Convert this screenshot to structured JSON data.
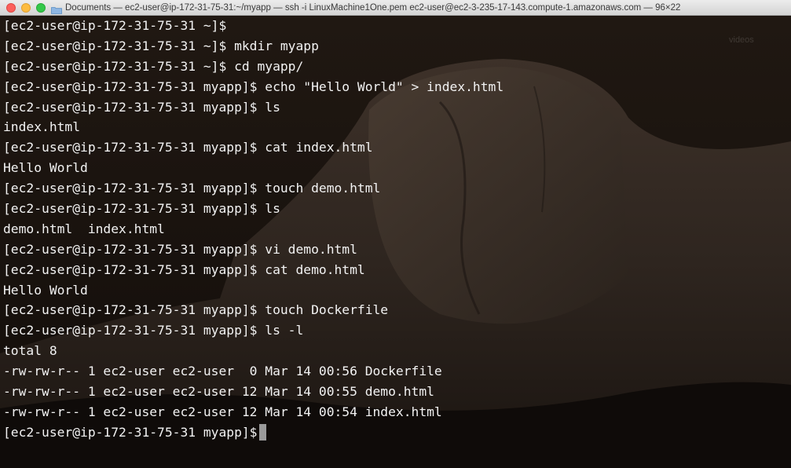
{
  "window": {
    "title": "Documents — ec2-user@ip-172-31-75-31:~/myapp — ssh -i LinuxMachine1One.pem ec2-user@ec2-3-235-17-143.compute-1.amazonaws.com — 96×22"
  },
  "watermark": "videos",
  "terminal": {
    "lines": [
      "[ec2-user@ip-172-31-75-31 ~]$",
      "[ec2-user@ip-172-31-75-31 ~]$ mkdir myapp",
      "[ec2-user@ip-172-31-75-31 ~]$ cd myapp/",
      "[ec2-user@ip-172-31-75-31 myapp]$ echo \"Hello World\" > index.html",
      "[ec2-user@ip-172-31-75-31 myapp]$ ls",
      "index.html",
      "[ec2-user@ip-172-31-75-31 myapp]$ cat index.html",
      "Hello World",
      "[ec2-user@ip-172-31-75-31 myapp]$ touch demo.html",
      "[ec2-user@ip-172-31-75-31 myapp]$ ls",
      "demo.html  index.html",
      "[ec2-user@ip-172-31-75-31 myapp]$ vi demo.html",
      "[ec2-user@ip-172-31-75-31 myapp]$ cat demo.html",
      "Hello World",
      "[ec2-user@ip-172-31-75-31 myapp]$ touch Dockerfile",
      "[ec2-user@ip-172-31-75-31 myapp]$ ls -l",
      "total 8",
      "-rw-rw-r-- 1 ec2-user ec2-user  0 Mar 14 00:56 Dockerfile",
      "-rw-rw-r-- 1 ec2-user ec2-user 12 Mar 14 00:55 demo.html",
      "-rw-rw-r-- 1 ec2-user ec2-user 12 Mar 14 00:54 index.html",
      "[ec2-user@ip-172-31-75-31 myapp]$"
    ]
  },
  "colors": {
    "text": "#f2f2f2",
    "background": "#16110d",
    "cursor": "#9a9a9a"
  }
}
